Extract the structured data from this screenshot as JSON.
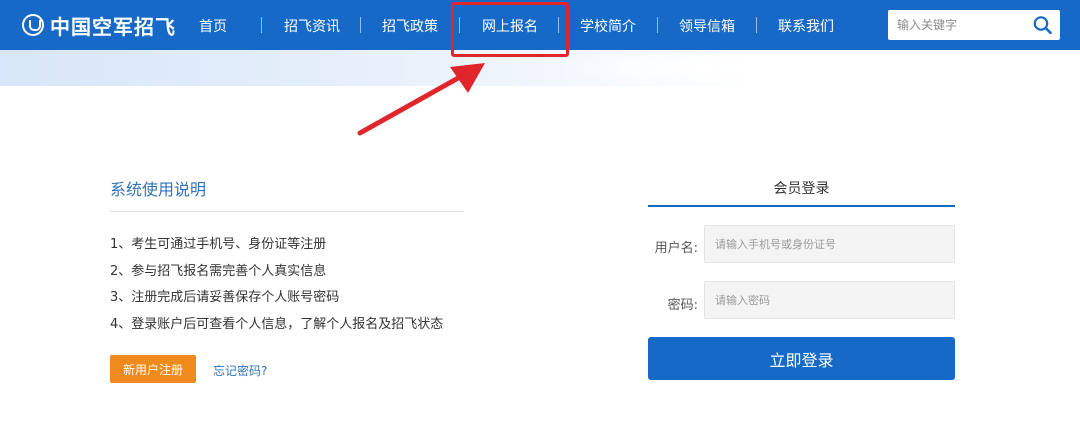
{
  "header": {
    "logo_text": "中国空军招飞",
    "nav": [
      {
        "label": "首页"
      },
      {
        "label": "招飞资讯"
      },
      {
        "label": "招飞政策"
      },
      {
        "label": "网上报名"
      },
      {
        "label": "学校简介"
      },
      {
        "label": "领导信箱"
      },
      {
        "label": "联系我们"
      }
    ],
    "search": {
      "placeholder": "输入关键字"
    },
    "colors": {
      "bar": "#1769c7",
      "highlight": "#e0262b"
    }
  },
  "info": {
    "title": "系统使用说明",
    "items": [
      "1、考生可通过手机号、身份证等注册",
      "2、参与招飞报名需完善个人真实信息",
      "3、注册完成后请妥善保存个人账号密码",
      "4、登录账户后可查看个人信息，了解个人报名及招飞状态"
    ],
    "register_label": "新用户注册",
    "forgot_label": "忘记密码?"
  },
  "login": {
    "title": "会员登录",
    "username_label": "用户名:",
    "username_placeholder": "请输入手机号或身份证号",
    "password_label": "密码:",
    "password_placeholder": "请输入密码",
    "submit_label": "立即登录"
  }
}
